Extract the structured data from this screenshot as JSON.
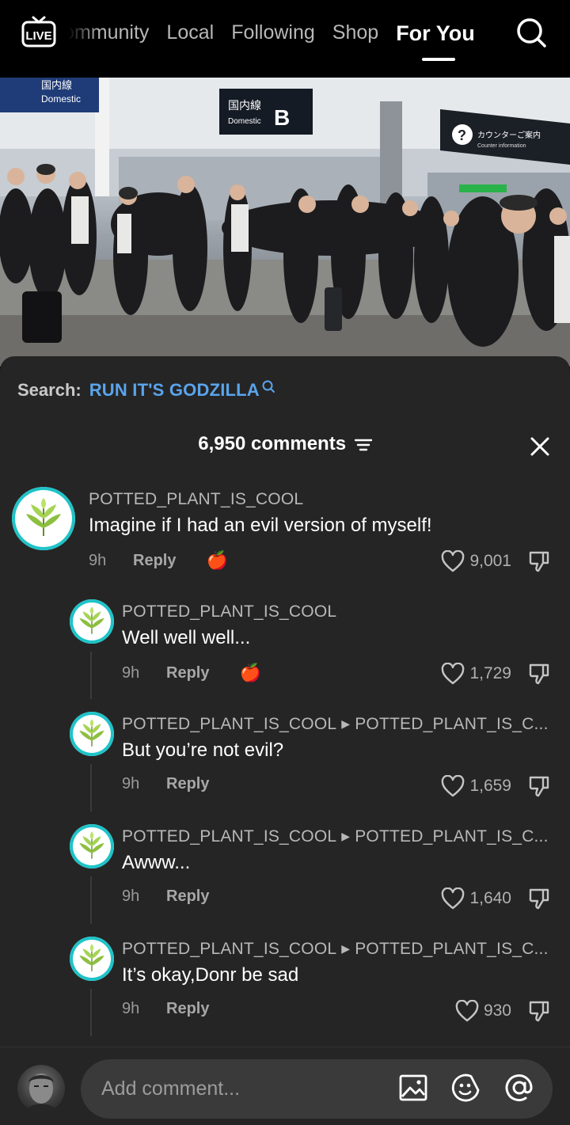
{
  "topnav": {
    "live_label": "LIVE",
    "tabs": [
      {
        "label": "Community",
        "visible_fragment": "mmunity"
      },
      {
        "label": "Local"
      },
      {
        "label": "Following"
      },
      {
        "label": "Shop"
      },
      {
        "label": "For You",
        "active": true
      }
    ],
    "icons": [
      "live-tv-icon",
      "search-icon"
    ]
  },
  "video": {
    "signs": {
      "left_sign_jp": "国内線",
      "left_sign_en": "Domestic",
      "center_sign_jp": "国内線",
      "center_sign_en": "Domestic",
      "center_sign_letter": "B",
      "right_sign_jp": "カウンターご案内",
      "right_sign_en": "Counter information"
    }
  },
  "comments_panel": {
    "search_prefix": "Search:",
    "search_term": "RUN IT'S GODZILLA",
    "count_label": "6,950 comments",
    "accent_color": "#5aa4ec",
    "avatar_ring_color": "#1ec3c8",
    "comments": [
      {
        "username": "POTTED_PLANT_IS_COOL",
        "reply_to": "",
        "text": "Imagine if I had an evil version of myself!",
        "time": "9h",
        "reply_label": "Reply",
        "likes": "9,001",
        "reaction": "🍎",
        "level": 0
      },
      {
        "username": "POTTED_PLANT_IS_COOL",
        "reply_to": "",
        "text": "Well well well...",
        "time": "9h",
        "reply_label": "Reply",
        "likes": "1,729",
        "reaction": "🍎",
        "level": 1
      },
      {
        "username": "POTTED_PLANT_IS_COOL",
        "reply_to": "POTTED_PLANT_IS_C...",
        "text": "But you’re not evil?",
        "time": "9h",
        "reply_label": "Reply",
        "likes": "1,659",
        "reaction": "",
        "level": 1
      },
      {
        "username": "POTTED_PLANT_IS_COOL",
        "reply_to": "POTTED_PLANT_IS_C...",
        "text": "Awww...",
        "time": "9h",
        "reply_label": "Reply",
        "likes": "1,640",
        "reaction": "",
        "level": 1
      },
      {
        "username": "POTTED_PLANT_IS_COOL",
        "reply_to": "POTTED_PLANT_IS_C...",
        "text": "It’s okay,Donr be sad",
        "time": "9h",
        "reply_label": "Reply",
        "likes": "930",
        "reaction": "",
        "level": 1
      }
    ]
  },
  "bottombar": {
    "input_placeholder": "Add comment...",
    "icons": [
      "image-icon",
      "emoji-icon",
      "mention-icon"
    ]
  }
}
